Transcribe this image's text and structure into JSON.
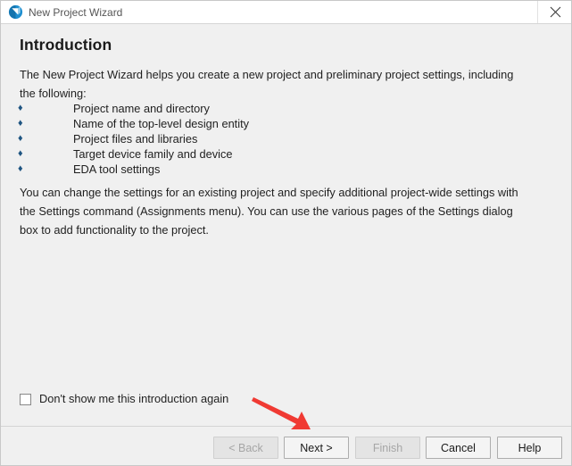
{
  "window": {
    "title": "New Project Wizard",
    "icon": "quartus-sphere-icon",
    "close_icon": "close-icon",
    "background_color": "#f0f0f0",
    "titlebar_color": "#ffffff"
  },
  "page": {
    "heading": "Introduction",
    "paragraphs": {
      "intro": "The New Project Wizard helps you create a new project and preliminary project settings, including the following:",
      "settings": "You can change the settings for an existing project and specify additional project-wide settings with the Settings command (Assignments menu). You can use the various pages of the Settings dialog box to add functionality to the project."
    },
    "bullets": [
      {
        "mark": "♦",
        "label": "Project name and directory"
      },
      {
        "mark": "♦",
        "label": "Name of the top-level design entity"
      },
      {
        "mark": "♦",
        "label": "Project files and libraries"
      },
      {
        "mark": "♦",
        "label": "Target device family and device"
      },
      {
        "mark": "♦",
        "label": "EDA tool settings"
      }
    ],
    "bullet_color": "#1f5582"
  },
  "checkbox": {
    "label": "Don't show me this introduction again",
    "checked": false
  },
  "buttons": [
    {
      "id": "back",
      "label": "< Back",
      "disabled": true
    },
    {
      "id": "next",
      "label": "Next >",
      "disabled": false
    },
    {
      "id": "finish",
      "label": "Finish",
      "disabled": true
    },
    {
      "id": "cancel",
      "label": "Cancel",
      "disabled": false
    },
    {
      "id": "help",
      "label": "Help",
      "disabled": false
    }
  ],
  "annotation": {
    "type": "arrow",
    "color": "#f03a33",
    "points_to": "next-button"
  }
}
